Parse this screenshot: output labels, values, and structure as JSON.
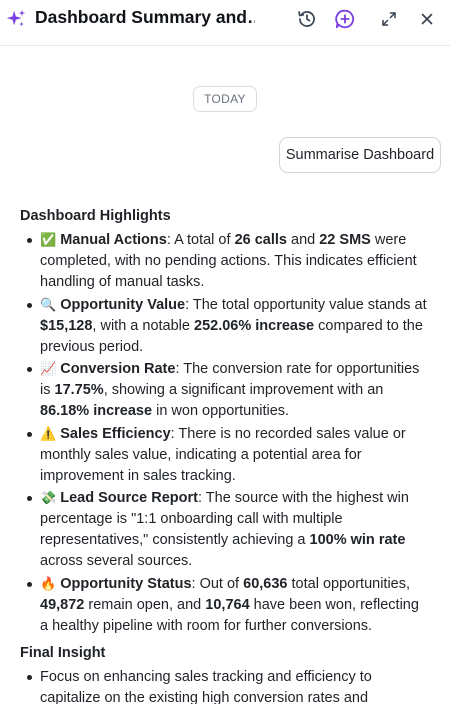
{
  "header": {
    "title": "Dashboard Summary and…",
    "icons": [
      "sparkle-icon",
      "history-icon",
      "new-chat-icon",
      "expand-icon",
      "close-icon"
    ]
  },
  "divider_label": "TODAY",
  "user_message": "Summarise Dashboard",
  "highlights": {
    "title": "Dashboard Highlights",
    "items": [
      {
        "emoji": "✅",
        "label": "Manual Actions",
        "t1": ": A total of ",
        "b1": "26 calls",
        "t2": " and ",
        "b2": "22 SMS",
        "t3": " were completed, with no pending actions. This indicates efficient handling of manual tasks."
      },
      {
        "emoji": "🔍",
        "label": "Opportunity Value",
        "t1": ": The total opportunity value stands at ",
        "b1": "$15,128",
        "t2": ", with a notable ",
        "b2": "252.06% increase",
        "t3": " compared to the previous period."
      },
      {
        "emoji": "📈",
        "label": "Conversion Rate",
        "t1": ": The conversion rate for opportunities is ",
        "b1": "17.75%",
        "t2": ", showing a significant improvement with an ",
        "b2": "86.18% increase",
        "t3": " in won opportunities."
      },
      {
        "emoji": "⚠️",
        "label": "Sales Efficiency",
        "t1": ": There is no recorded sales value or monthly sales value, indicating a potential area for improvement in sales tracking."
      },
      {
        "emoji": "💸",
        "label": "Lead Source Report",
        "t1": ": The source with the highest win percentage is \"1:1 onboarding call with multiple representatives,\" consistently achieving a ",
        "b1": "100% win rate",
        "t2": " across several sources."
      },
      {
        "emoji": "🔥",
        "label": "Opportunity Status",
        "t1": ": Out of ",
        "b1": "60,636",
        "t2": " total opportunities, ",
        "b2": "49,872",
        "t3": " remain open, and ",
        "b3": "10,764",
        "t4": " have been won, reflecting a healthy pipeline with room for further conversions."
      }
    ]
  },
  "final_insight": {
    "title": "Final Insight",
    "items": [
      {
        "text": "Focus on enhancing sales tracking and efficiency to capitalize on the existing high conversion rates and"
      }
    ]
  },
  "colors": {
    "accent": "#7b3fe4",
    "icon": "#4b5563",
    "border": "#d0d4d9"
  }
}
